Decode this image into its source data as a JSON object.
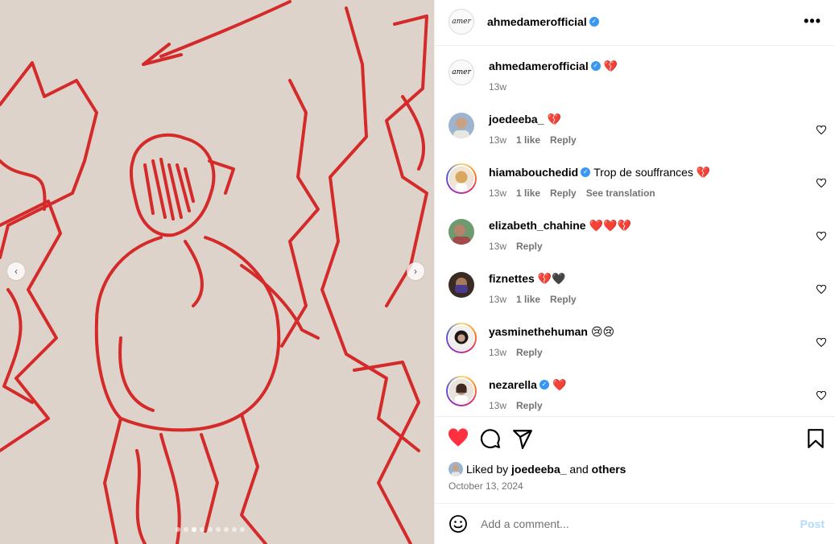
{
  "post": {
    "author": "ahmedamerofficial",
    "avatar_text": "amer",
    "verified": true
  },
  "caption": {
    "username": "ahmedamerofficial",
    "text": "💔",
    "time": "13w"
  },
  "comments": [
    {
      "username": "joedeeba_",
      "verified": false,
      "text": "💔",
      "time": "13w",
      "likes": "1 like",
      "reply": "Reply",
      "translate": ""
    },
    {
      "username": "hiamabouchedid",
      "verified": true,
      "text": "Trop de souffrances 💔",
      "time": "13w",
      "likes": "1 like",
      "reply": "Reply",
      "translate": "See translation"
    },
    {
      "username": "elizabeth_chahine",
      "verified": false,
      "text": "❤️❤️💔",
      "time": "13w",
      "likes": "",
      "reply": "Reply",
      "translate": ""
    },
    {
      "username": "fiznettes",
      "verified": false,
      "text": "💔🖤",
      "time": "13w",
      "likes": "1 like",
      "reply": "Reply",
      "translate": ""
    },
    {
      "username": "yasminethehuman",
      "verified": false,
      "text": "😢😢",
      "time": "13w",
      "likes": "",
      "reply": "Reply",
      "translate": ""
    },
    {
      "username": "nezarella",
      "verified": true,
      "text": "❤️",
      "time": "13w",
      "likes": "",
      "reply": "Reply",
      "translate": ""
    }
  ],
  "likes": {
    "prefix": "Liked by",
    "user": "joedeeba_",
    "middle": "and",
    "others": "others"
  },
  "date": "October 13, 2024",
  "add_comment": {
    "placeholder": "Add a comment...",
    "post_label": "Post"
  },
  "carousel": {
    "total": 9,
    "active_index": 2
  },
  "colors": {
    "like_red": "#ff3040",
    "verified_blue": "#3897f0",
    "meta_gray": "#737373",
    "post_disabled": "#b3dbff",
    "sketch_red": "#d42a2a",
    "paper": "#ddd3cb"
  },
  "icons": [
    "more-icon",
    "heart-filled-icon",
    "comment-icon",
    "share-icon",
    "bookmark-icon",
    "emoji-icon",
    "heart-outline-icon",
    "chevron-left-icon",
    "chevron-right-icon",
    "verified-icon"
  ]
}
